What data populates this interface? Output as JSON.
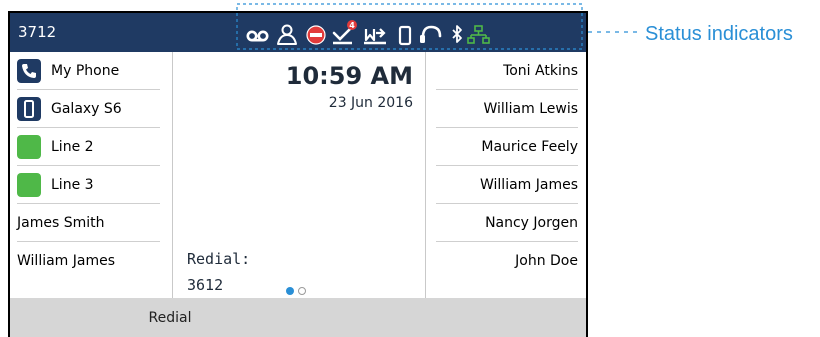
{
  "header": {
    "extension": "3712",
    "status_icons": [
      "voicemail-icon",
      "presence-icon",
      "do-not-disturb-icon",
      "missed-calls-icon",
      "call-forward-icon",
      "mobile-device-icon",
      "headset-icon",
      "bluetooth-icon",
      "network-icon"
    ],
    "missed_calls_count": "4"
  },
  "left_keys": [
    {
      "label": "My Phone",
      "icon": "phone-icon"
    },
    {
      "label": "Galaxy S6",
      "icon": "mobile-icon"
    },
    {
      "label": "Line 2",
      "icon": "line-status-icon"
    },
    {
      "label": "Line 3",
      "icon": "line-status-icon"
    },
    {
      "label": "James Smith"
    },
    {
      "label": "William James"
    }
  ],
  "idle": {
    "time": "10:59 AM",
    "date": "23 Jun 2016",
    "redial_label": "Redial:",
    "redial_number": "3612",
    "page_count": 2,
    "current_page": 1
  },
  "right_keys": [
    {
      "label": "Toni Atkins"
    },
    {
      "label": "William Lewis"
    },
    {
      "label": "Maurice Feely"
    },
    {
      "label": "William James"
    },
    {
      "label": "Nancy Jorgen"
    },
    {
      "label": "John Doe"
    }
  ],
  "softkeys": [
    {
      "label": "Redial"
    }
  ],
  "annotation": {
    "label": "Status indicators"
  },
  "colors": {
    "header_bg": "#1f3a63",
    "line_green": "#4fb848",
    "accent_blue": "#2a8fd6",
    "dnd_red": "#e23b3b",
    "softkey_bar": "#d6d6d6"
  }
}
